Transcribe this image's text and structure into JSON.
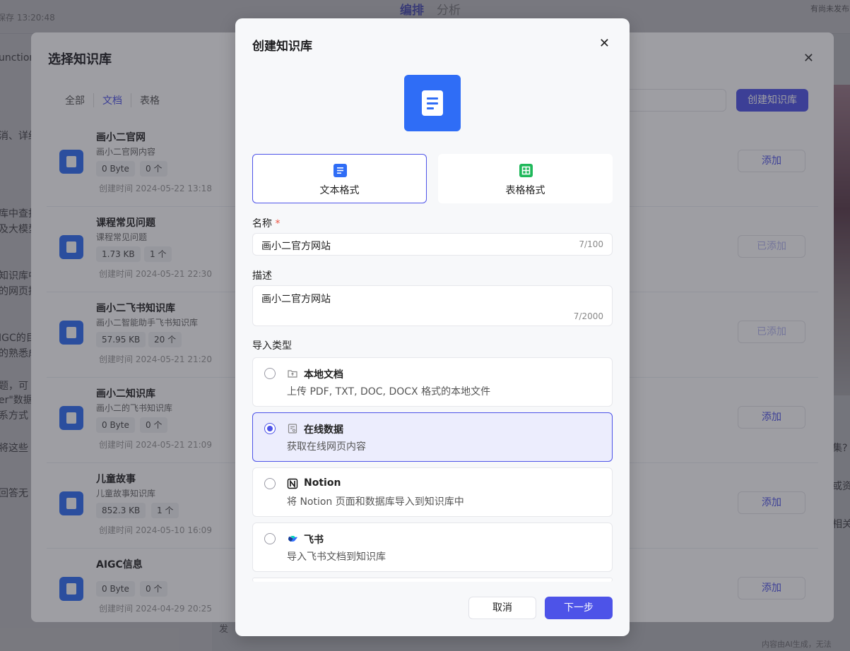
{
  "background": {
    "save_status": "保存 13:20:48",
    "tabs": [
      "编排",
      "分析"
    ],
    "hint": "有尚未发布的",
    "left_fragments": [
      "unction",
      "消、详细",
      "库中查找",
      "及大模型",
      "知识库中",
      "的网页提",
      "IGC的目",
      "的熟悉成",
      "题，可",
      "er\"数据",
      "系方式",
      "将这些",
      "回答无"
    ],
    "right_fragments": [
      "集?",
      "或资",
      "相关"
    ],
    "bottom_left": "发",
    "bottom_right": "内容由AI生成，无法"
  },
  "select_dialog": {
    "title": "选择知识库",
    "tabs": [
      "全部",
      "文档",
      "表格"
    ],
    "create_label": "创建知识库",
    "items": [
      {
        "name": "画小二官网",
        "desc": "画小二官网内容",
        "size": "0 Byte",
        "count": "0 个",
        "time": "创建时间 2024-05-22 13:18",
        "action": "添加"
      },
      {
        "name": "课程常见问题",
        "desc": "课程常见问题",
        "size": "1.73 KB",
        "count": "1 个",
        "time": "创建时间 2024-05-21 22:30",
        "action": "已添加"
      },
      {
        "name": "画小二飞书知识库",
        "desc": "画小二智能助手飞书知识库",
        "size": "57.95 KB",
        "count": "20 个",
        "time": "创建时间 2024-05-21 21:20",
        "action": "已添加"
      },
      {
        "name": "画小二知识库",
        "desc": "画小二的飞书知识库",
        "size": "0 Byte",
        "count": "0 个",
        "time": "创建时间 2024-05-21 21:09",
        "action": "添加"
      },
      {
        "name": "儿童故事",
        "desc": "儿童故事知识库",
        "size": "852.3 KB",
        "count": "1 个",
        "time": "创建时间 2024-05-10 16:09",
        "action": "添加"
      },
      {
        "name": "AIGC信息",
        "desc": "",
        "size": "0 Byte",
        "count": "0 个",
        "time": "创建时间 2024-04-29 20:25",
        "action": "添加"
      }
    ]
  },
  "create_dialog": {
    "title": "创建知识库",
    "formats": [
      {
        "label": "文本格式",
        "selected": true
      },
      {
        "label": "表格格式",
        "selected": false
      }
    ],
    "name_label": "名称",
    "required_mark": "*",
    "name_value": "画小二官方网站",
    "name_count": "7/100",
    "desc_label": "描述",
    "desc_value": "画小二官方网站",
    "desc_count": "7/2000",
    "import_label": "导入类型",
    "import_options": [
      {
        "name": "本地文档",
        "desc": "上传 PDF, TXT, DOC, DOCX 格式的本地文件",
        "icon": "folder-upload-icon",
        "selected": false
      },
      {
        "name": "在线数据",
        "desc": "获取在线网页内容",
        "icon": "web-page-icon",
        "selected": true
      },
      {
        "name": "Notion",
        "desc": "将 Notion 页面和数据库导入到知识库中",
        "icon": "notion-icon",
        "selected": false
      },
      {
        "name": "飞书",
        "desc": "导入飞书文档到知识库",
        "icon": "feishu-icon",
        "selected": false
      }
    ],
    "cancel_label": "取消",
    "next_label": "下一步"
  },
  "colors": {
    "primary": "#4d53e8",
    "doc_blue": "#2f6df6",
    "sheet_green": "#1fb85a"
  }
}
